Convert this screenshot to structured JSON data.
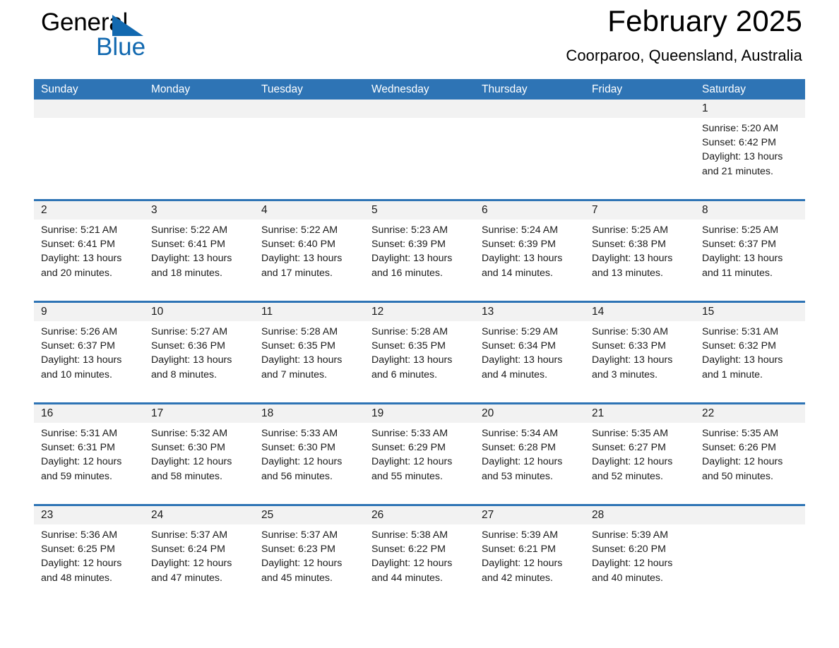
{
  "logo": {
    "word_one": "General",
    "word_two": "Blue",
    "triangle_color": "#1269b0"
  },
  "header": {
    "title": "February 2025",
    "subtitle": "Coorparoo, Queensland, Australia"
  },
  "theme": {
    "header_blue": "#2e74b5",
    "daynum_band": "#f2f2f2",
    "text": "#1a1a1a"
  },
  "weekdays": [
    "Sunday",
    "Monday",
    "Tuesday",
    "Wednesday",
    "Thursday",
    "Friday",
    "Saturday"
  ],
  "weeks": [
    [
      {
        "day": "",
        "lines": []
      },
      {
        "day": "",
        "lines": []
      },
      {
        "day": "",
        "lines": []
      },
      {
        "day": "",
        "lines": []
      },
      {
        "day": "",
        "lines": []
      },
      {
        "day": "",
        "lines": []
      },
      {
        "day": "1",
        "lines": [
          "Sunrise: 5:20 AM",
          "Sunset: 6:42 PM",
          "Daylight: 13 hours",
          "and 21 minutes."
        ]
      }
    ],
    [
      {
        "day": "2",
        "lines": [
          "Sunrise: 5:21 AM",
          "Sunset: 6:41 PM",
          "Daylight: 13 hours",
          "and 20 minutes."
        ]
      },
      {
        "day": "3",
        "lines": [
          "Sunrise: 5:22 AM",
          "Sunset: 6:41 PM",
          "Daylight: 13 hours",
          "and 18 minutes."
        ]
      },
      {
        "day": "4",
        "lines": [
          "Sunrise: 5:22 AM",
          "Sunset: 6:40 PM",
          "Daylight: 13 hours",
          "and 17 minutes."
        ]
      },
      {
        "day": "5",
        "lines": [
          "Sunrise: 5:23 AM",
          "Sunset: 6:39 PM",
          "Daylight: 13 hours",
          "and 16 minutes."
        ]
      },
      {
        "day": "6",
        "lines": [
          "Sunrise: 5:24 AM",
          "Sunset: 6:39 PM",
          "Daylight: 13 hours",
          "and 14 minutes."
        ]
      },
      {
        "day": "7",
        "lines": [
          "Sunrise: 5:25 AM",
          "Sunset: 6:38 PM",
          "Daylight: 13 hours",
          "and 13 minutes."
        ]
      },
      {
        "day": "8",
        "lines": [
          "Sunrise: 5:25 AM",
          "Sunset: 6:37 PM",
          "Daylight: 13 hours",
          "and 11 minutes."
        ]
      }
    ],
    [
      {
        "day": "9",
        "lines": [
          "Sunrise: 5:26 AM",
          "Sunset: 6:37 PM",
          "Daylight: 13 hours",
          "and 10 minutes."
        ]
      },
      {
        "day": "10",
        "lines": [
          "Sunrise: 5:27 AM",
          "Sunset: 6:36 PM",
          "Daylight: 13 hours",
          "and 8 minutes."
        ]
      },
      {
        "day": "11",
        "lines": [
          "Sunrise: 5:28 AM",
          "Sunset: 6:35 PM",
          "Daylight: 13 hours",
          "and 7 minutes."
        ]
      },
      {
        "day": "12",
        "lines": [
          "Sunrise: 5:28 AM",
          "Sunset: 6:35 PM",
          "Daylight: 13 hours",
          "and 6 minutes."
        ]
      },
      {
        "day": "13",
        "lines": [
          "Sunrise: 5:29 AM",
          "Sunset: 6:34 PM",
          "Daylight: 13 hours",
          "and 4 minutes."
        ]
      },
      {
        "day": "14",
        "lines": [
          "Sunrise: 5:30 AM",
          "Sunset: 6:33 PM",
          "Daylight: 13 hours",
          "and 3 minutes."
        ]
      },
      {
        "day": "15",
        "lines": [
          "Sunrise: 5:31 AM",
          "Sunset: 6:32 PM",
          "Daylight: 13 hours",
          "and 1 minute."
        ]
      }
    ],
    [
      {
        "day": "16",
        "lines": [
          "Sunrise: 5:31 AM",
          "Sunset: 6:31 PM",
          "Daylight: 12 hours",
          "and 59 minutes."
        ]
      },
      {
        "day": "17",
        "lines": [
          "Sunrise: 5:32 AM",
          "Sunset: 6:30 PM",
          "Daylight: 12 hours",
          "and 58 minutes."
        ]
      },
      {
        "day": "18",
        "lines": [
          "Sunrise: 5:33 AM",
          "Sunset: 6:30 PM",
          "Daylight: 12 hours",
          "and 56 minutes."
        ]
      },
      {
        "day": "19",
        "lines": [
          "Sunrise: 5:33 AM",
          "Sunset: 6:29 PM",
          "Daylight: 12 hours",
          "and 55 minutes."
        ]
      },
      {
        "day": "20",
        "lines": [
          "Sunrise: 5:34 AM",
          "Sunset: 6:28 PM",
          "Daylight: 12 hours",
          "and 53 minutes."
        ]
      },
      {
        "day": "21",
        "lines": [
          "Sunrise: 5:35 AM",
          "Sunset: 6:27 PM",
          "Daylight: 12 hours",
          "and 52 minutes."
        ]
      },
      {
        "day": "22",
        "lines": [
          "Sunrise: 5:35 AM",
          "Sunset: 6:26 PM",
          "Daylight: 12 hours",
          "and 50 minutes."
        ]
      }
    ],
    [
      {
        "day": "23",
        "lines": [
          "Sunrise: 5:36 AM",
          "Sunset: 6:25 PM",
          "Daylight: 12 hours",
          "and 48 minutes."
        ]
      },
      {
        "day": "24",
        "lines": [
          "Sunrise: 5:37 AM",
          "Sunset: 6:24 PM",
          "Daylight: 12 hours",
          "and 47 minutes."
        ]
      },
      {
        "day": "25",
        "lines": [
          "Sunrise: 5:37 AM",
          "Sunset: 6:23 PM",
          "Daylight: 12 hours",
          "and 45 minutes."
        ]
      },
      {
        "day": "26",
        "lines": [
          "Sunrise: 5:38 AM",
          "Sunset: 6:22 PM",
          "Daylight: 12 hours",
          "and 44 minutes."
        ]
      },
      {
        "day": "27",
        "lines": [
          "Sunrise: 5:39 AM",
          "Sunset: 6:21 PM",
          "Daylight: 12 hours",
          "and 42 minutes."
        ]
      },
      {
        "day": "28",
        "lines": [
          "Sunrise: 5:39 AM",
          "Sunset: 6:20 PM",
          "Daylight: 12 hours",
          "and 40 minutes."
        ]
      },
      {
        "day": "",
        "lines": []
      }
    ]
  ]
}
